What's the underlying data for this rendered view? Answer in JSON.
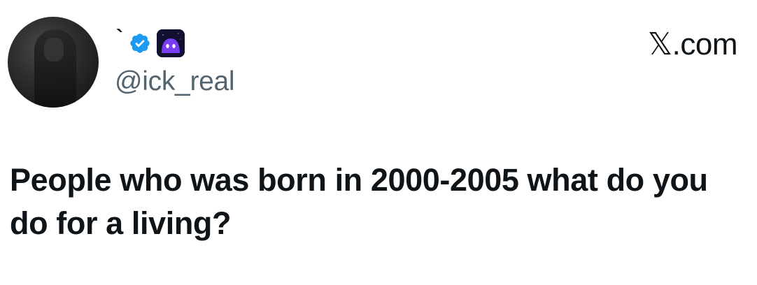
{
  "author": {
    "display_name": "`",
    "handle": "@ick_real",
    "avatar_icon": "profile-photo",
    "badges": [
      "verified-badge-icon",
      "bot-affiliate-icon"
    ]
  },
  "source": {
    "site_label": "𝕏.com"
  },
  "tweet": {
    "text": "People who was born in 2000-2005 what do you do for a living?"
  },
  "colors": {
    "text_primary": "#0f1419",
    "text_secondary": "#536471",
    "verified_blue": "#1d9bf0",
    "bot_purple": "#7b3cf5"
  }
}
